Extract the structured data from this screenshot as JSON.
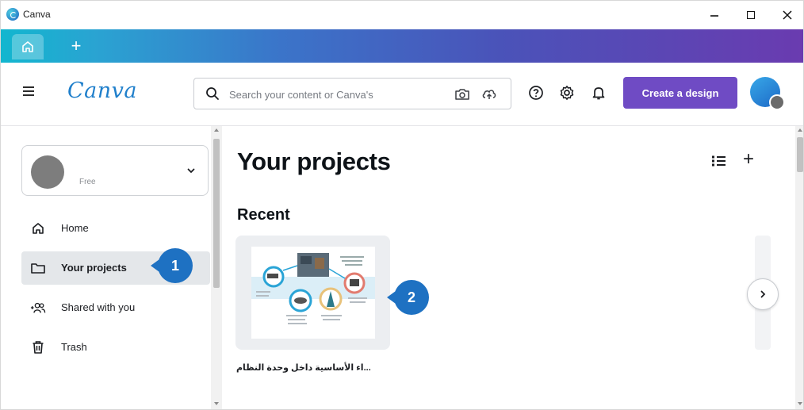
{
  "window": {
    "title": "Canva",
    "controls": [
      "minimize",
      "maximize",
      "close"
    ]
  },
  "tabs": {
    "home_icon": "home-icon",
    "new_tab_icon": "plus-icon",
    "new_tab_label": "+"
  },
  "header": {
    "logo": "Canva",
    "search_placeholder": "Search your content or Canva's",
    "icons": [
      "camera-search-icon",
      "upload-icon",
      "help-icon",
      "gear-icon",
      "bell-icon"
    ],
    "create_button": "Create a design",
    "accent_color": "#6f4bc4",
    "logo_color": "#1f7fcb"
  },
  "sidebar": {
    "account": {
      "plan": "Free"
    },
    "items": [
      {
        "label": "Home",
        "icon": "home-icon",
        "active": false
      },
      {
        "label": "Your projects",
        "icon": "folder-icon",
        "active": true
      },
      {
        "label": "Shared with you",
        "icon": "shared-people-icon",
        "active": false
      },
      {
        "label": "Trash",
        "icon": "trash-icon",
        "active": false
      }
    ]
  },
  "main": {
    "title": "Your projects",
    "section": "Recent",
    "add_label": "+",
    "projects": [
      {
        "name": "...اء الأساسية داخل وحدة النظام"
      }
    ]
  },
  "callouts": {
    "first": "1",
    "second": "2",
    "color": "#1e71c2"
  }
}
